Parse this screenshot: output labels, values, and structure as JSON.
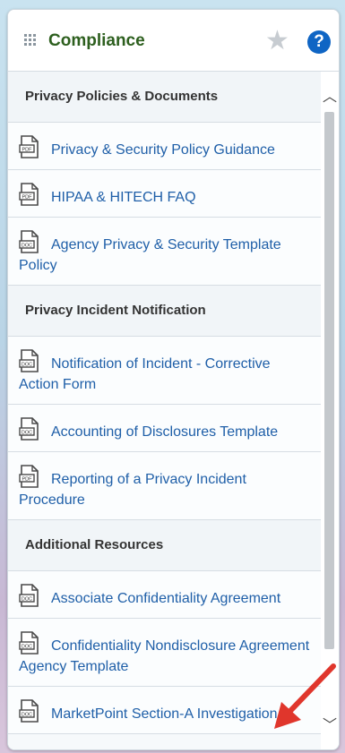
{
  "widget": {
    "title": "Compliance",
    "star_icon": "star-icon",
    "help_icon": "help-icon",
    "help_glyph": "?"
  },
  "sections": [
    {
      "label": "Privacy Policies & Documents",
      "items": [
        {
          "label": "Privacy & Security Policy Guidance",
          "icon": "pdf-document-icon"
        },
        {
          "label": "HIPAA & HITECH FAQ",
          "icon": "pdf-document-icon"
        },
        {
          "label": "Agency Privacy & Security Template Policy",
          "icon": "doc-document-icon"
        }
      ]
    },
    {
      "label": "Privacy Incident Notification",
      "items": [
        {
          "label": "Notification of Incident - Corrective Action Form",
          "icon": "doc-document-icon"
        },
        {
          "label": "Accounting of Disclosures Template",
          "icon": "doc-document-icon"
        },
        {
          "label": "Reporting of a Privacy Incident Procedure",
          "icon": "pdf-document-icon"
        }
      ]
    },
    {
      "label": "Additional Resources",
      "items": [
        {
          "label": "Associate Confidentiality Agreement",
          "icon": "doc-document-icon"
        },
        {
          "label": "Confidentiality Nondisclosure Agreement Agency Template",
          "icon": "doc-document-icon"
        },
        {
          "label": "MarketPoint Section-A Investigation",
          "icon": "doc-document-icon"
        }
      ]
    }
  ],
  "colors": {
    "title": "#2d5f1e",
    "link": "#1f5fa8",
    "help_button": "#0f65c4",
    "annotation_arrow": "#e0362c"
  }
}
